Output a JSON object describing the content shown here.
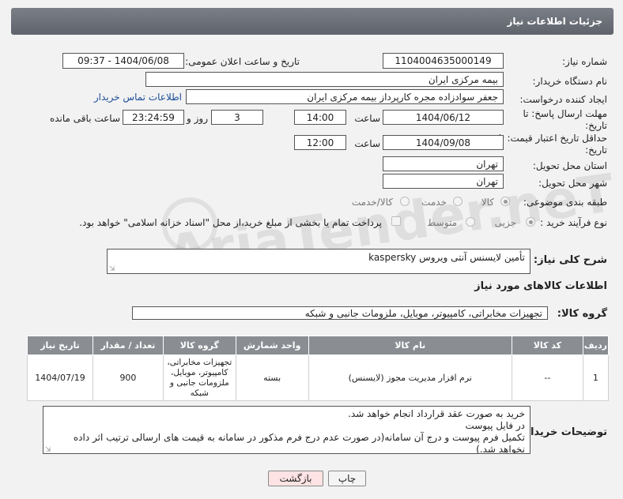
{
  "header": {
    "title": "جزئیات اطلاعات نیاز"
  },
  "form": {
    "need_number": {
      "label": "شماره نیاز:",
      "value": "1104004635000149"
    },
    "announce_date": {
      "label": "تاریخ و ساعت اعلان عمومی:",
      "value": "1404/06/08 - 09:37"
    },
    "buyer_org": {
      "label": "نام دستگاه خریدار:",
      "value": "بیمه مرکزی ایران"
    },
    "requester": {
      "label": "ایجاد کننده درخواست:",
      "value": "جعفر سوادزاده مجره کارپرداز بیمه مرکزی ایران",
      "contact_link": "اطلاعات تماس خریدار"
    },
    "reply_deadline": {
      "label": "مهلت ارسال پاسخ: تا تاریخ:",
      "date": "1404/06/12",
      "time_label": "ساعت",
      "time": "14:00",
      "days": "3",
      "days_label": "روز و",
      "remaining": "23:24:59",
      "remaining_label": "ساعت باقی مانده"
    },
    "price_deadline": {
      "label": "حداقل تاریخ اعتبار قیمت: تا تاریخ:",
      "date": "1404/09/08",
      "time_label": "ساعت",
      "time": "12:00"
    },
    "delivery_province": {
      "label": "استان محل تحویل:",
      "value": "تهران"
    },
    "delivery_city": {
      "label": "شهر محل تحویل:",
      "value": "تهران"
    },
    "category": {
      "label": "طبقه بندی موضوعی:",
      "options": [
        "کالا",
        "خدمت",
        "کالا/خدمت"
      ],
      "selected": "کالا"
    },
    "process_type": {
      "label": "نوع فرآیند خرید :",
      "options": [
        "جزیی",
        "متوسط"
      ],
      "selected": "جزیی",
      "payment_note": "پرداخت تمام یا بخشی از مبلغ خرید،از محل \"اسناد خزانه اسلامی\" خواهد بود."
    },
    "summary": {
      "label": "شرح کلی نیاز:",
      "value": "تأمین لایسنس آنتی ویروس kaspersky"
    },
    "goods_section_title": "اطلاعات کالاهای مورد نیاز",
    "goods_group": {
      "label": "گروه کالا:",
      "value": "تجهیزات مخابراتی، کامپیوتر، موبایل، ملزومات جانبی و شبکه"
    }
  },
  "table": {
    "headers": [
      "ردیف",
      "کد کالا",
      "نام کالا",
      "واحد شمارش",
      "گروه کالا",
      "تعداد / مقدار",
      "تاریخ نیاز"
    ],
    "rows": [
      [
        "1",
        "--",
        "نرم افزار مدیریت مجوز (لایسنس)",
        "بسته",
        "تجهیزات مخابراتی، کامپیوتر، موبایل، ملزومات جانبی و شبکه",
        "900",
        "1404/07/19"
      ]
    ]
  },
  "buyer_notes": {
    "label": "توضیحات خریدار:",
    "lines": [
      "خرید به صورت عقد قرارداد انجام خواهد شد.",
      "در فایل پیوست",
      "تکمیل فرم پیوست و درج آن سامانه(در صورت عدم درج فرم مذکور در سامانه به قیمت های ارسالی ترتیب اثر داده نخواهد شد.)"
    ]
  },
  "buttons": {
    "print": "چاپ",
    "back": "بازگشت"
  },
  "watermark": "AriaTender.neT",
  "colors": {
    "header_bg": "#6b6f77",
    "table_header": "#8a8d92",
    "link": "#1a4d99",
    "back_button": "#fde3e3"
  }
}
